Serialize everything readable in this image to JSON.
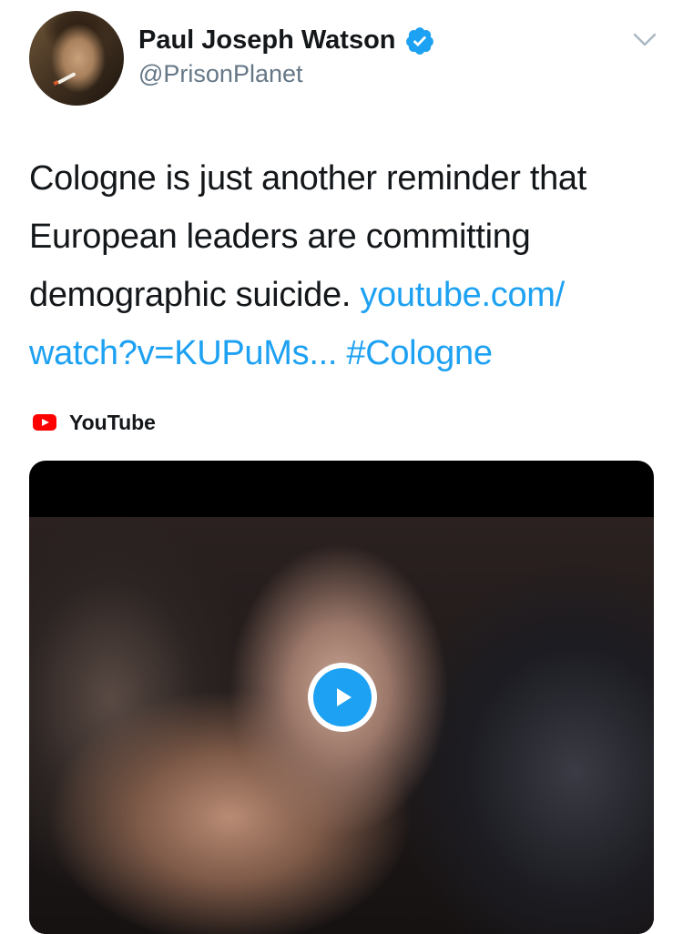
{
  "author": {
    "name": "Paul Joseph Watson",
    "handle": "@PrisonPlanet",
    "verified": true
  },
  "tweet": {
    "text_lines": [
      "Cologne is just another reminder that",
      "European leaders are committing",
      "demographic suicide. "
    ],
    "link_part1": "youtube.com/",
    "link_part2": "watch?v=KUPuMs...",
    "hashtag": "#Cologne"
  },
  "card": {
    "source": "YouTube",
    "source_icon": "youtube-icon",
    "play_icon": "play-icon"
  },
  "colors": {
    "link": "#1da1f2",
    "youtube_red": "#ff0000",
    "handle_gray": "#657786"
  }
}
